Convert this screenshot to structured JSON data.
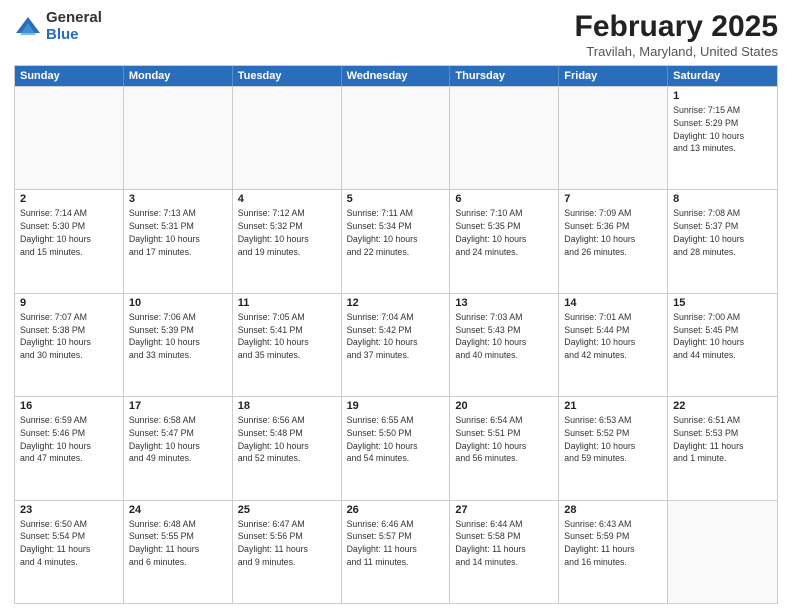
{
  "header": {
    "logo_general": "General",
    "logo_blue": "Blue",
    "month_title": "February 2025",
    "location": "Travilah, Maryland, United States"
  },
  "days_of_week": [
    "Sunday",
    "Monday",
    "Tuesday",
    "Wednesday",
    "Thursday",
    "Friday",
    "Saturday"
  ],
  "weeks": [
    [
      {
        "day": "",
        "info": ""
      },
      {
        "day": "",
        "info": ""
      },
      {
        "day": "",
        "info": ""
      },
      {
        "day": "",
        "info": ""
      },
      {
        "day": "",
        "info": ""
      },
      {
        "day": "",
        "info": ""
      },
      {
        "day": "1",
        "info": "Sunrise: 7:15 AM\nSunset: 5:29 PM\nDaylight: 10 hours\nand 13 minutes."
      }
    ],
    [
      {
        "day": "2",
        "info": "Sunrise: 7:14 AM\nSunset: 5:30 PM\nDaylight: 10 hours\nand 15 minutes."
      },
      {
        "day": "3",
        "info": "Sunrise: 7:13 AM\nSunset: 5:31 PM\nDaylight: 10 hours\nand 17 minutes."
      },
      {
        "day": "4",
        "info": "Sunrise: 7:12 AM\nSunset: 5:32 PM\nDaylight: 10 hours\nand 19 minutes."
      },
      {
        "day": "5",
        "info": "Sunrise: 7:11 AM\nSunset: 5:34 PM\nDaylight: 10 hours\nand 22 minutes."
      },
      {
        "day": "6",
        "info": "Sunrise: 7:10 AM\nSunset: 5:35 PM\nDaylight: 10 hours\nand 24 minutes."
      },
      {
        "day": "7",
        "info": "Sunrise: 7:09 AM\nSunset: 5:36 PM\nDaylight: 10 hours\nand 26 minutes."
      },
      {
        "day": "8",
        "info": "Sunrise: 7:08 AM\nSunset: 5:37 PM\nDaylight: 10 hours\nand 28 minutes."
      }
    ],
    [
      {
        "day": "9",
        "info": "Sunrise: 7:07 AM\nSunset: 5:38 PM\nDaylight: 10 hours\nand 30 minutes."
      },
      {
        "day": "10",
        "info": "Sunrise: 7:06 AM\nSunset: 5:39 PM\nDaylight: 10 hours\nand 33 minutes."
      },
      {
        "day": "11",
        "info": "Sunrise: 7:05 AM\nSunset: 5:41 PM\nDaylight: 10 hours\nand 35 minutes."
      },
      {
        "day": "12",
        "info": "Sunrise: 7:04 AM\nSunset: 5:42 PM\nDaylight: 10 hours\nand 37 minutes."
      },
      {
        "day": "13",
        "info": "Sunrise: 7:03 AM\nSunset: 5:43 PM\nDaylight: 10 hours\nand 40 minutes."
      },
      {
        "day": "14",
        "info": "Sunrise: 7:01 AM\nSunset: 5:44 PM\nDaylight: 10 hours\nand 42 minutes."
      },
      {
        "day": "15",
        "info": "Sunrise: 7:00 AM\nSunset: 5:45 PM\nDaylight: 10 hours\nand 44 minutes."
      }
    ],
    [
      {
        "day": "16",
        "info": "Sunrise: 6:59 AM\nSunset: 5:46 PM\nDaylight: 10 hours\nand 47 minutes."
      },
      {
        "day": "17",
        "info": "Sunrise: 6:58 AM\nSunset: 5:47 PM\nDaylight: 10 hours\nand 49 minutes."
      },
      {
        "day": "18",
        "info": "Sunrise: 6:56 AM\nSunset: 5:48 PM\nDaylight: 10 hours\nand 52 minutes."
      },
      {
        "day": "19",
        "info": "Sunrise: 6:55 AM\nSunset: 5:50 PM\nDaylight: 10 hours\nand 54 minutes."
      },
      {
        "day": "20",
        "info": "Sunrise: 6:54 AM\nSunset: 5:51 PM\nDaylight: 10 hours\nand 56 minutes."
      },
      {
        "day": "21",
        "info": "Sunrise: 6:53 AM\nSunset: 5:52 PM\nDaylight: 10 hours\nand 59 minutes."
      },
      {
        "day": "22",
        "info": "Sunrise: 6:51 AM\nSunset: 5:53 PM\nDaylight: 11 hours\nand 1 minute."
      }
    ],
    [
      {
        "day": "23",
        "info": "Sunrise: 6:50 AM\nSunset: 5:54 PM\nDaylight: 11 hours\nand 4 minutes."
      },
      {
        "day": "24",
        "info": "Sunrise: 6:48 AM\nSunset: 5:55 PM\nDaylight: 11 hours\nand 6 minutes."
      },
      {
        "day": "25",
        "info": "Sunrise: 6:47 AM\nSunset: 5:56 PM\nDaylight: 11 hours\nand 9 minutes."
      },
      {
        "day": "26",
        "info": "Sunrise: 6:46 AM\nSunset: 5:57 PM\nDaylight: 11 hours\nand 11 minutes."
      },
      {
        "day": "27",
        "info": "Sunrise: 6:44 AM\nSunset: 5:58 PM\nDaylight: 11 hours\nand 14 minutes."
      },
      {
        "day": "28",
        "info": "Sunrise: 6:43 AM\nSunset: 5:59 PM\nDaylight: 11 hours\nand 16 minutes."
      },
      {
        "day": "",
        "info": ""
      }
    ]
  ]
}
